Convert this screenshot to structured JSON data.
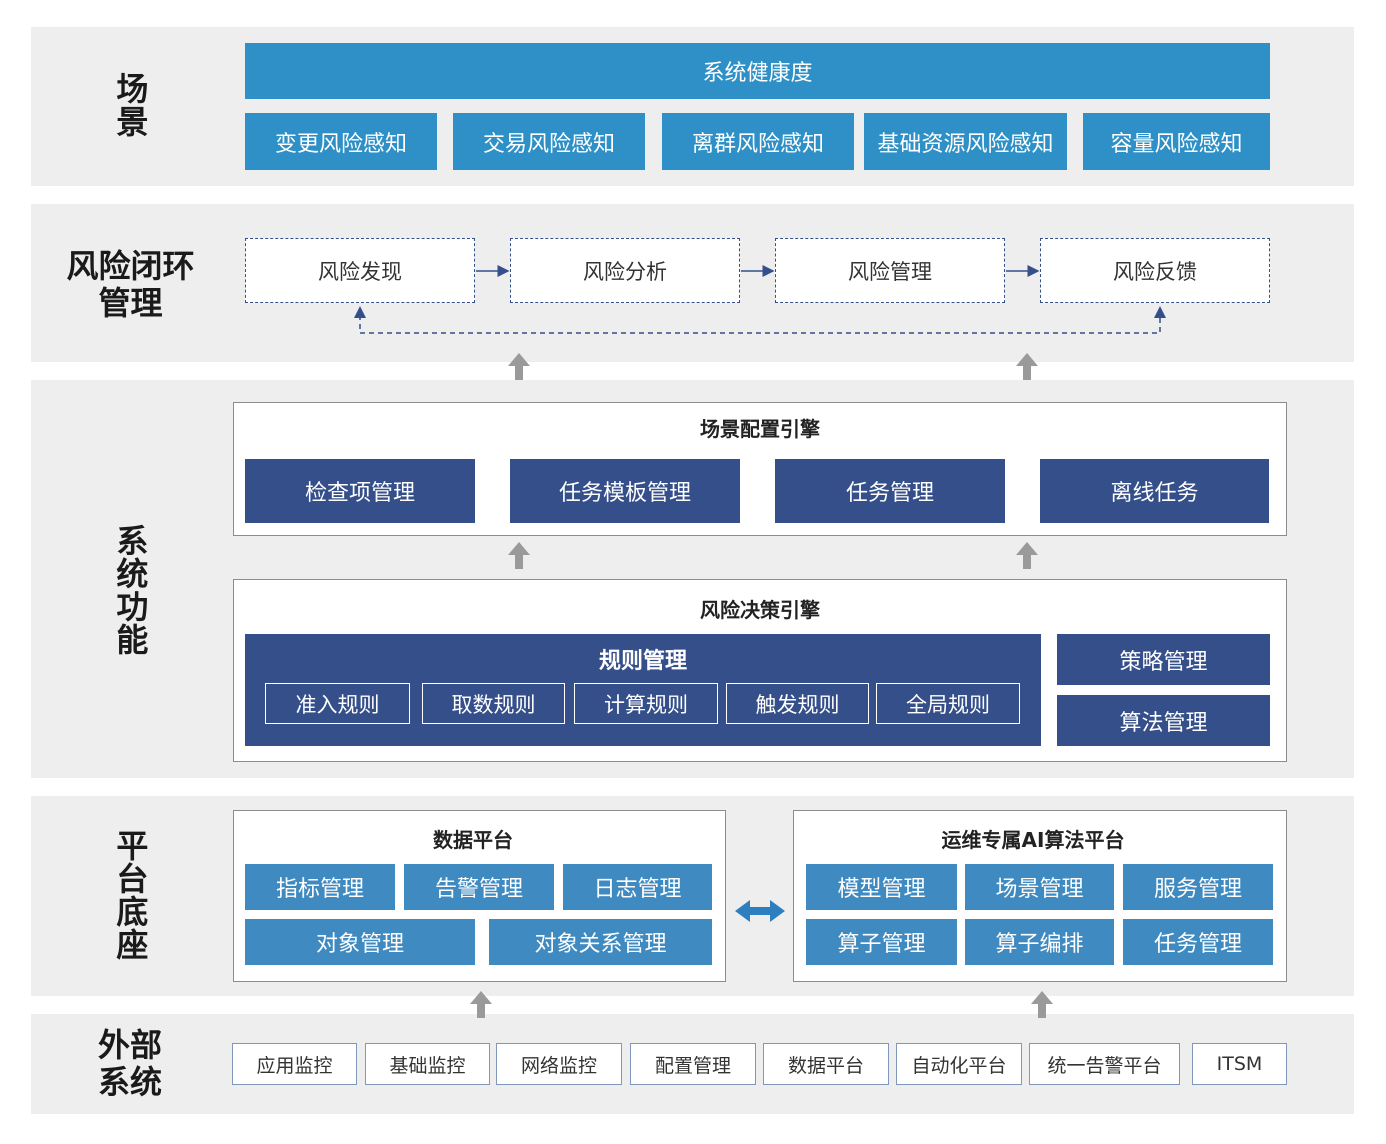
{
  "rows": {
    "scene": "场景",
    "risk_loop": "风险闭环管理",
    "system_function": "系统功能",
    "platform_base": "平台底座",
    "external_system": "外部系统"
  },
  "scene": {
    "health": "系统健康度",
    "items": [
      "变更风险感知",
      "交易风险感知",
      "离群风险感知",
      "基础资源风险感知",
      "容量风险感知"
    ]
  },
  "risk_loop": {
    "steps": [
      "风险发现",
      "风险分析",
      "风险管理",
      "风险反馈"
    ]
  },
  "scene_engine": {
    "title": "场景配置引擎",
    "items": [
      "检查项管理",
      "任务模板管理",
      "任务管理",
      "离线任务"
    ]
  },
  "decision_engine": {
    "title": "风险决策引擎",
    "rules": {
      "title": "规则管理",
      "items": [
        "准入规则",
        "取数规则",
        "计算规则",
        "触发规则",
        "全局规则"
      ]
    },
    "side": [
      "策略管理",
      "算法管理"
    ]
  },
  "data_platform": {
    "title": "数据平台",
    "row1": [
      "指标管理",
      "告警管理",
      "日志管理"
    ],
    "row2": [
      "对象管理",
      "对象关系管理"
    ]
  },
  "ai_platform": {
    "title": "运维专属AI算法平台",
    "row1": [
      "模型管理",
      "场景管理",
      "服务管理"
    ],
    "row2": [
      "算子管理",
      "算子编排",
      "任务管理"
    ]
  },
  "external": {
    "items": [
      "应用监控",
      "基础监控",
      "网络监控",
      "配置管理",
      "数据平台",
      "自动化平台",
      "统一告警平台",
      "ITSM"
    ]
  }
}
